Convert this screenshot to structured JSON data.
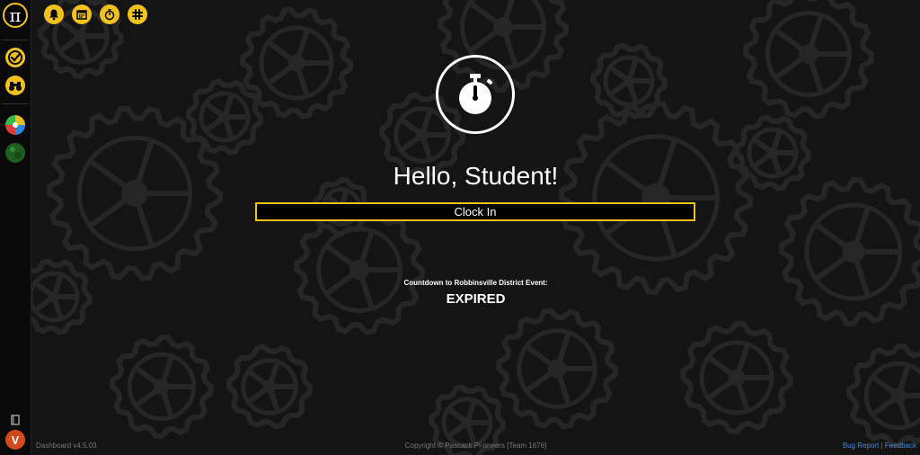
{
  "app": {
    "logo_symbol": "π",
    "accent_color": "#f2c21a"
  },
  "topbar": {
    "buttons": [
      {
        "icon": "bell-icon"
      },
      {
        "icon": "calendar-icon"
      },
      {
        "icon": "stopwatch-icon"
      },
      {
        "icon": "slack-icon"
      }
    ]
  },
  "sidebar": {
    "items": [
      {
        "icon": "check-circle-icon"
      },
      {
        "icon": "binoculars-icon"
      },
      {
        "icon": "pinwheel-icon"
      },
      {
        "icon": "green-globe-icon"
      }
    ],
    "bottom_icon": "book-icon",
    "avatar_initial": "V"
  },
  "main": {
    "timer_icon": "stopwatch-icon",
    "greeting": "Hello, Student!",
    "clock_in_label": "Clock In",
    "countdown_label": "Countdown to Robbinsville District Event:",
    "countdown_value": "EXPIRED"
  },
  "footer": {
    "version": "Dashboard v4.5.03",
    "copyright": "Copyright © Pascack Pi-oneers [Team 1676]",
    "bug_report": "Bug Report",
    "separator": "|",
    "feedback": "Feedback"
  }
}
